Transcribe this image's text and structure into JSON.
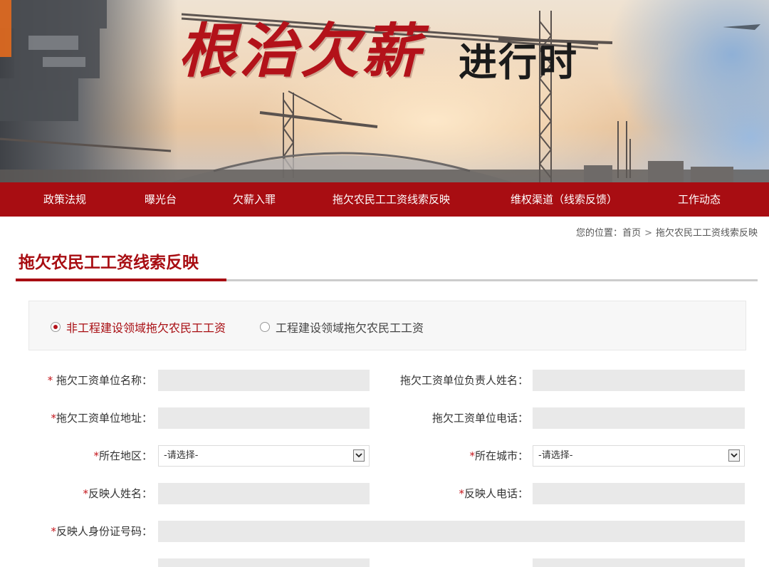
{
  "banner": {
    "title_red": "根治欠薪",
    "title_black": "进行时"
  },
  "nav": {
    "items": [
      {
        "label": "政策法规"
      },
      {
        "label": "曝光台"
      },
      {
        "label": "欠薪入罪"
      },
      {
        "label": "拖欠农民工工资线索反映"
      },
      {
        "label": "维权渠道（线索反馈）"
      },
      {
        "label": "工作动态"
      }
    ]
  },
  "breadcrumb": {
    "prefix": "您的位置：",
    "home": "首页",
    "separator": ">",
    "current": "拖欠农民工工资线索反映"
  },
  "page": {
    "title": "拖欠农民工工资线索反映"
  },
  "radio": {
    "options": [
      {
        "label": "非工程建设领域拖欠农民工工资",
        "checked": true
      },
      {
        "label": "工程建设领域拖欠农民工工资",
        "checked": false
      }
    ]
  },
  "form": {
    "required_mark": "*",
    "fields": {
      "unit_name": {
        "label": "拖欠工资单位名称：",
        "required": true,
        "value": ""
      },
      "unit_leader": {
        "label": "拖欠工资单位负责人姓名：",
        "required": false,
        "value": ""
      },
      "unit_address": {
        "label": "拖欠工资单位地址：",
        "required": true,
        "value": ""
      },
      "unit_phone": {
        "label": "拖欠工资单位电话：",
        "required": false,
        "value": ""
      },
      "region": {
        "label": "所在地区：",
        "required": true,
        "selected": "-请选择-"
      },
      "city": {
        "label": "所在城市：",
        "required": true,
        "selected": "-请选择-"
      },
      "reporter_name": {
        "label": "反映人姓名：",
        "required": true,
        "value": ""
      },
      "reporter_phone": {
        "label": "反映人电话：",
        "required": true,
        "value": ""
      },
      "reporter_id": {
        "label": "反映人身份证号码：",
        "required": true,
        "value": ""
      }
    }
  },
  "colors": {
    "brand_red": "#a80d12",
    "title_red": "#b3121a",
    "input_bg": "#e9e9e9"
  }
}
